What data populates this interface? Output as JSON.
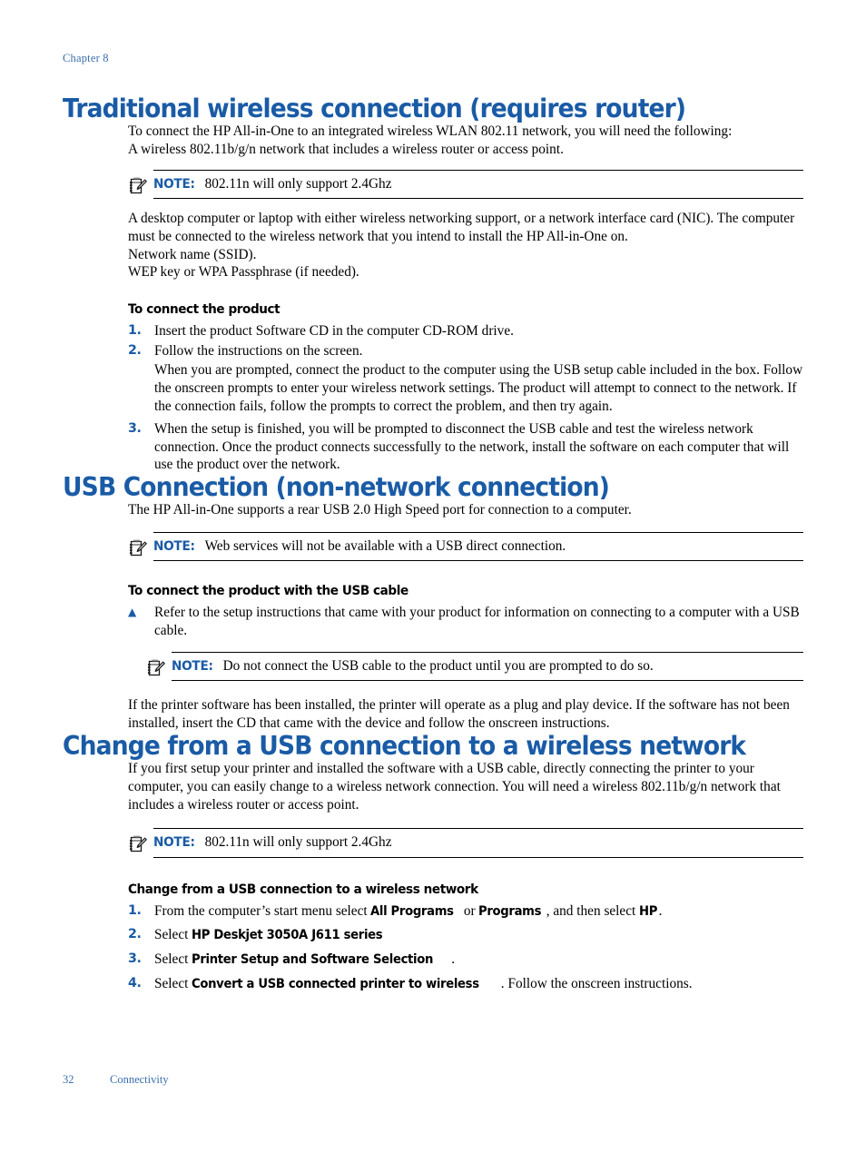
{
  "colors": {
    "heading_blue": "#1a5ba6",
    "footer_blue": "#3a6ead",
    "rule_black": "#000000",
    "body_black": "#000000"
  },
  "header": {
    "chapter": "Chapter 8"
  },
  "footer": {
    "page_number": "32",
    "section_name": "Connectivity"
  },
  "icons": {
    "note": "note-clipboard-pencil-icon",
    "triangle_bullet": "▲"
  },
  "sections": [
    {
      "title": "Traditional wireless connection (requires router)",
      "intro": "To connect the HP All-in-One to an integrated wireless WLAN 802.11 network, you will need the following:",
      "requirement": "A wireless 802.11b/g/n network that includes a wireless router or access point.",
      "note": {
        "label": "NOTE:",
        "text": "802.11n will only support 2.4Ghz"
      },
      "paragraphs": [
        "A desktop computer or laptop with either wireless networking support, or a network interface card (NIC). The computer must be connected to the wireless network that you intend to install the HP All-in-One on.",
        "Network name (SSID).",
        "WEP key or WPA Passphrase (if needed)."
      ],
      "procedure": {
        "title": "To connect the product",
        "steps": [
          {
            "marker": "1.",
            "text": "Insert the product Software CD in the computer CD-ROM drive."
          },
          {
            "marker": "2.",
            "text": "Follow the instructions on the screen.",
            "sub": "When you are prompted, connect the product to the computer using the USB setup cable included in the box. Follow the onscreen prompts to enter your wireless network settings. The product will attempt to connect to the network. If the connection fails, follow the prompts to correct the problem, and then try again."
          },
          {
            "marker": "3.",
            "text": "When the setup is finished, you will be prompted to disconnect the USB cable and test the wireless network connection. Once the product connects successfully to the network, install the software on each computer that will use the product over the network."
          }
        ]
      }
    },
    {
      "title": "USB Connection (non-network connection)",
      "intro": "The HP All-in-One supports a rear USB 2.0 High Speed port for connection to a computer.",
      "note": {
        "label": "NOTE:",
        "text": "Web services will not be available with a USB direct connection."
      },
      "procedure": {
        "title": "To connect the product with the USB cable",
        "steps": [
          {
            "marker": "▲",
            "text": "Refer to the setup instructions that came with your product for information on connecting to a computer with a USB cable."
          }
        ]
      },
      "nested_note": {
        "label": "NOTE:",
        "text": "Do not connect the USB cable to the product until you are prompted to do so."
      },
      "closing": "If the printer software has been installed, the printer will operate as a plug and play device. If the software has not been installed, insert the CD that came with the device and follow the onscreen instructions."
    },
    {
      "title": "Change from a USB connection to a wireless network",
      "intro": "If you first setup your printer and installed the software with a USB cable, directly connecting the printer to your computer, you can easily change to a wireless network connection. You will need a wireless 802.11b/g/n network that includes a wireless router or access point.",
      "note": {
        "label": "NOTE:",
        "text": "802.11n will only support 2.4Ghz"
      },
      "procedure": {
        "title": "Change from a USB connection to a wireless network",
        "steps": [
          {
            "marker": "1.",
            "pre": "From the computer’s start menu select ",
            "bold1": "All Programs",
            "mid1": " or ",
            "bold2": "Programs",
            "mid2": ", and then select ",
            "bold3": "HP",
            "post": "."
          },
          {
            "marker": "2.",
            "pre": "Select ",
            "bold1": "HP Deskjet 3050A J611 series",
            "post": ""
          },
          {
            "marker": "3.",
            "pre": "Select ",
            "bold1": "Printer Setup and Software Selection",
            "post": "."
          },
          {
            "marker": "4.",
            "pre": "Select ",
            "bold1": "Convert a USB connected printer to wireless",
            "post": ". Follow the onscreen instructions."
          }
        ]
      }
    }
  ]
}
